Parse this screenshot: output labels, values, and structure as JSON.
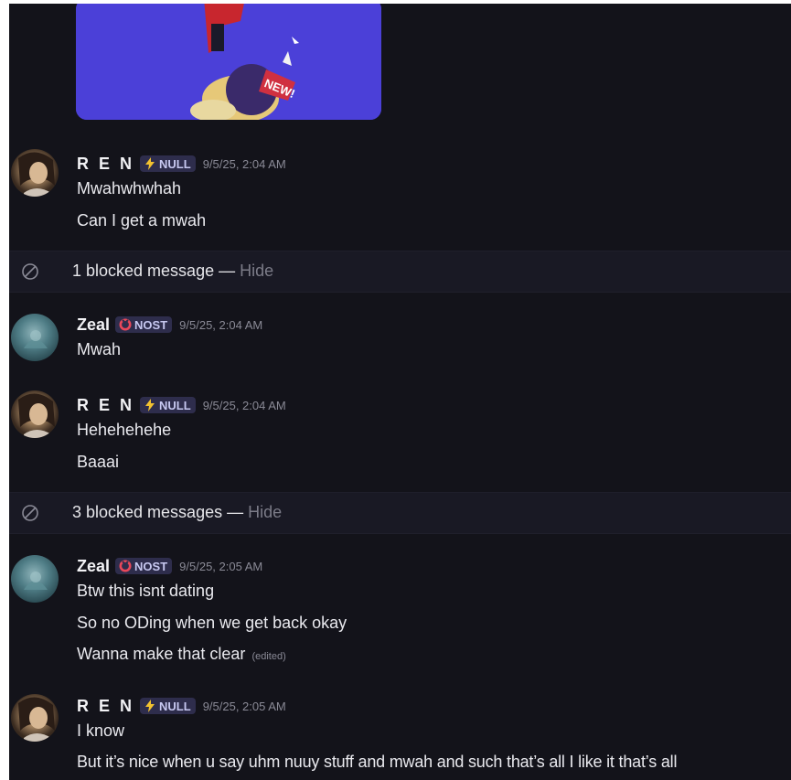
{
  "embed": {
    "sticker_text": "NEW!",
    "icon": "gif-image"
  },
  "messages": [
    {
      "author": "R E N",
      "tag": "NULL",
      "tag_icon": "lightning-icon",
      "timestamp": "9/5/25, 2:04 AM",
      "lines": [
        "Mwahwhwhah",
        "Can I get a mwah"
      ]
    },
    {
      "author": "Zeal",
      "tag": "NOST",
      "tag_icon": "ring-icon",
      "timestamp": "9/5/25, 2:04 AM",
      "lines": [
        "Mwah"
      ]
    },
    {
      "author": "R E N",
      "tag": "NULL",
      "tag_icon": "lightning-icon",
      "timestamp": "9/5/25, 2:04 AM",
      "lines": [
        "Hehehehehe",
        "Baaai"
      ]
    },
    {
      "author": "Zeal",
      "tag": "NOST",
      "tag_icon": "ring-icon",
      "timestamp": "9/5/25, 2:05 AM",
      "lines": [
        "Btw this isnt dating",
        "So no ODing when we get back okay",
        "Wanna make that clear"
      ],
      "edited_label": "(edited)"
    },
    {
      "author": "R E N",
      "tag": "NULL",
      "tag_icon": "lightning-icon",
      "timestamp": "9/5/25, 2:05 AM",
      "lines": [
        "I know",
        "But it’s nice when u say uhm nuuy stuff and mwah and such that’s all I like it that’s all"
      ]
    }
  ],
  "blocked": [
    {
      "text": "1 blocked message —",
      "action": "Hide"
    },
    {
      "text": "3 blocked messages —",
      "action": "Hide"
    }
  ],
  "colors": {
    "background": "#13131a",
    "blocked_bar": "#191924",
    "tag_bg": "#2e2d4c",
    "tag_text": "#c7c8f0",
    "lightning": "#f2c230",
    "ring": "#e8485a",
    "muted": "#8a8a96",
    "embed_purple": "#4a3ad0"
  }
}
